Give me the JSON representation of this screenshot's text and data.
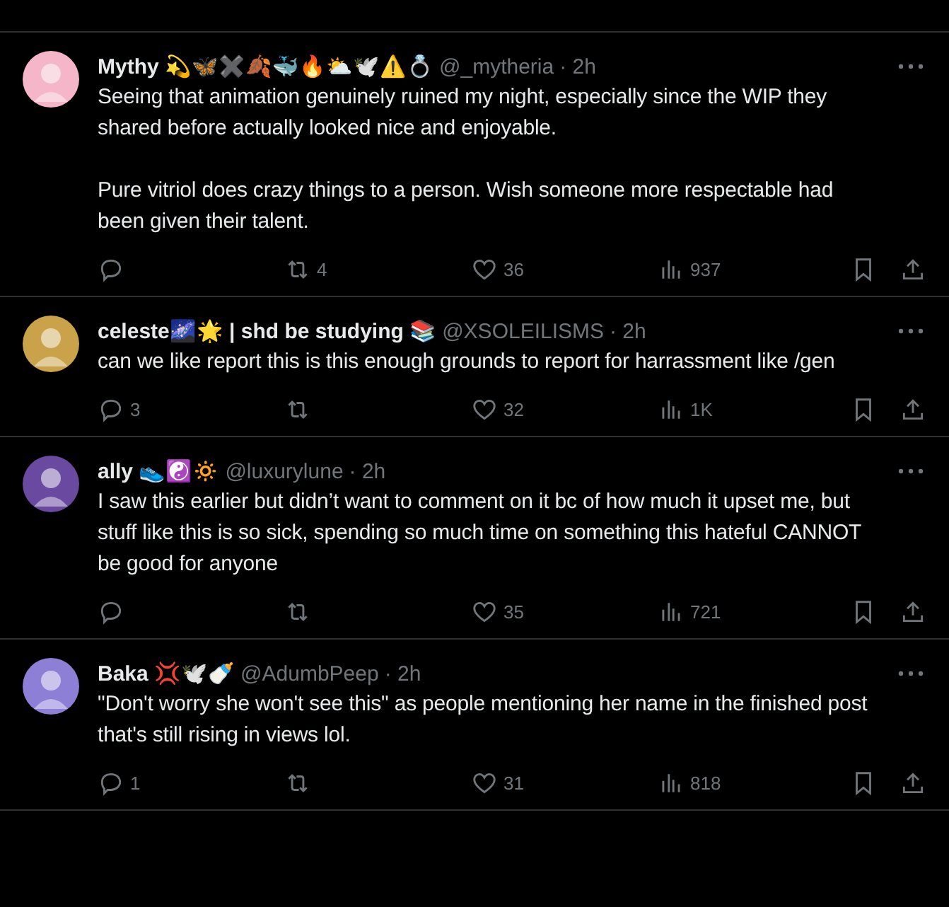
{
  "tweets": [
    {
      "name": "Mythy 💫🦋✖️🍂🐳🔥⛅🕊️⚠️💍",
      "handle": "@_mytheria",
      "time": "· 2h",
      "paragraphs": [
        "Seeing that animation genuinely ruined my night, especially since the WIP they shared before actually looked nice and enjoyable.",
        "Pure vitriol does crazy things to a person. Wish someone more respectable had been given their talent."
      ],
      "reposts": "4",
      "likes": "36",
      "views": "937"
    },
    {
      "name": "celeste🌌🌟 | shd be studying 📚",
      "handle": "@XSOLEILISMS",
      "time": "· 2h",
      "paragraphs": [
        "can we like report this is this enough grounds to report for harrassment like /gen"
      ],
      "replies": "3",
      "likes": "32",
      "views": "1K"
    },
    {
      "name": "ally 👟☯️🔅",
      "handle": "@luxurylune",
      "time": "· 2h",
      "paragraphs": [
        "I saw this earlier but didn’t want to comment on it bc of how much it upset me, but stuff like this is so sick, spending so much time on something this hateful CANNOT be good for anyone"
      ],
      "likes": "35",
      "views": "721"
    },
    {
      "name": "Baka 💢🕊️🍼",
      "handle": "@AdumbPeep",
      "time": "· 2h",
      "paragraphs": [
        "\"Don't worry she won't see this\" as people mentioning her name in the finished post that's still rising in views lol."
      ],
      "replies": "1",
      "likes": "31",
      "views": "818"
    }
  ]
}
